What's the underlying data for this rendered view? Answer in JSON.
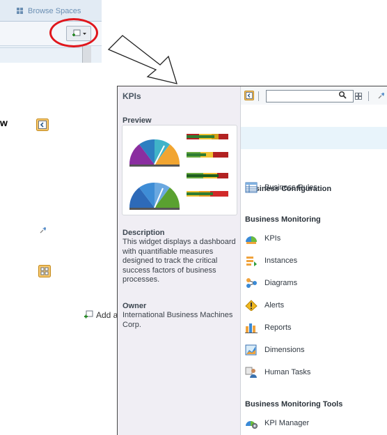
{
  "header_crop": {
    "browse_label": "Browse Spaces"
  },
  "left_legend": {
    "w_letter": "w",
    "add_widget_label": "Add a widget"
  },
  "panel": {
    "title": "KPIs",
    "preview_label": "Preview",
    "description_label": "Description",
    "description_text": "This widget displays a dashboard with quantifiable measures designed to track the critical success factors of business processes.",
    "owner_label": "Owner",
    "owner_text": "International Business Machines Corp."
  },
  "toolbar": {
    "search_value": "",
    "search_placeholder": ""
  },
  "categories": [
    {
      "title": "Business Configuration",
      "items": [
        {
          "label": "Business Rules",
          "icon": "business-rules-icon"
        }
      ]
    },
    {
      "title": "Business Monitoring",
      "items": [
        {
          "label": "KPIs",
          "icon": "kpis-icon"
        },
        {
          "label": "Instances",
          "icon": "instances-icon"
        },
        {
          "label": "Diagrams",
          "icon": "diagrams-icon"
        },
        {
          "label": "Alerts",
          "icon": "alerts-icon"
        },
        {
          "label": "Reports",
          "icon": "reports-icon"
        },
        {
          "label": "Dimensions",
          "icon": "dimensions-icon"
        },
        {
          "label": "Human Tasks",
          "icon": "human-tasks-icon"
        }
      ]
    },
    {
      "title": "Business Monitoring Tools",
      "items": [
        {
          "label": "KPI Manager",
          "icon": "kpi-manager-icon"
        }
      ]
    }
  ],
  "colors": {
    "highlight_oval": "#e0161c",
    "accent_orange": "#f0a33c",
    "band_blue": "#e8f4fb"
  }
}
